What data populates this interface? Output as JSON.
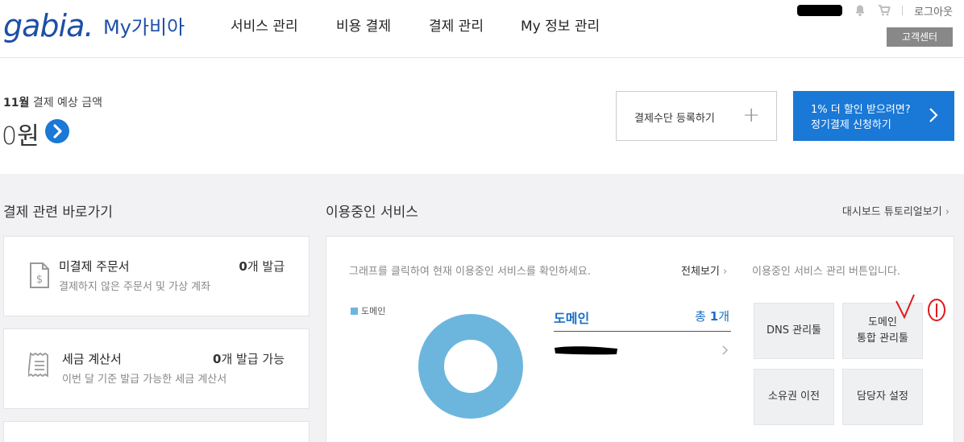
{
  "header": {
    "logo_text": "gabia",
    "logo_dot": ".",
    "brand": "My가비아",
    "nav": [
      "서비스 관리",
      "비용 결제",
      "결제 관리",
      "My 정보 관리"
    ],
    "logout": "로그아웃",
    "customer_center": "고객센터"
  },
  "summary": {
    "month": "11월",
    "label_rest": " 결제 예상 금액",
    "amount": "0원",
    "register_payment": "결제수단 등록하기",
    "plus_icon": "+",
    "promo_line1": "1% 더 할인 받으려면?",
    "promo_line2": "정기결제 신청하기"
  },
  "shortcuts": {
    "title": "결제 관련 바로가기",
    "items": [
      {
        "title": "미결제 주문서",
        "desc": "결제하지 않은 주문서 및 가상 계좌",
        "count": "0",
        "count_suffix": "개 발급",
        "icon": "invoice-icon"
      },
      {
        "title": "세금 계산서",
        "desc": "이번 달 기준 발급 가능한 세금 계산서",
        "count": "0",
        "count_suffix": "개 발급 가능",
        "icon": "receipt-icon"
      }
    ]
  },
  "services": {
    "title": "이용중인 서비스",
    "tutorial": "대시보드 튜토리얼보기",
    "hint": "그래프를 클릭하여 현재 이용중인 서비스를 확인하세요.",
    "view_all": "전체보기",
    "btn_hint": "이용중인 서비스 관리 버튼입니다.",
    "legend": "도메인",
    "donut_color": "#6cb6de",
    "domain_label": "도메인",
    "total_prefix": "총 ",
    "total_count": "1",
    "total_suffix": "개",
    "buttons": [
      "DNS 관리툴",
      "도메인\n통합 관리툴",
      "소유권 이전",
      "담당자 설정"
    ]
  },
  "colors": {
    "brand_blue": "#1d4fa6",
    "accent_blue": "#1a78d6",
    "annotation_red": "#e0191e"
  }
}
